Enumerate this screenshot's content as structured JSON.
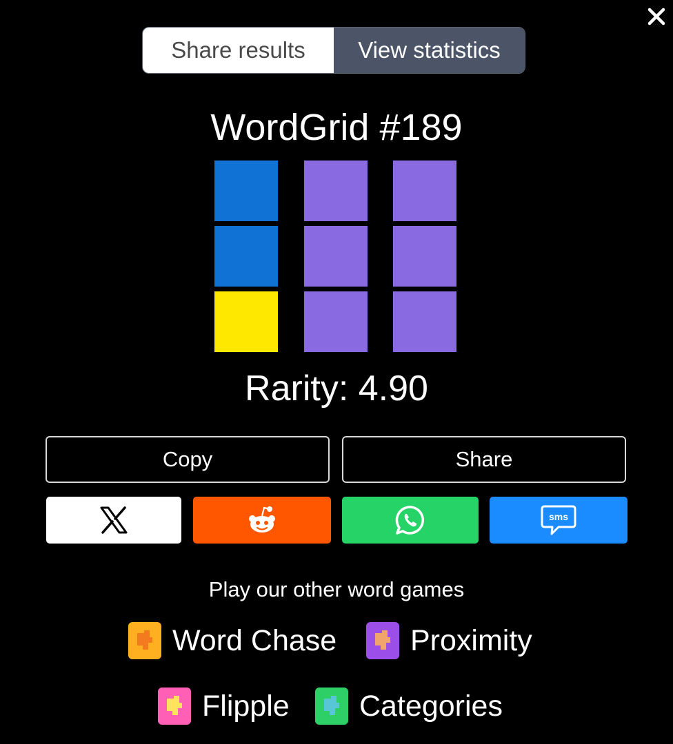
{
  "close_label": "✕",
  "tabs": [
    {
      "label": "Share results",
      "active": false
    },
    {
      "label": "View statistics",
      "active": true
    }
  ],
  "result": {
    "title": "WordGrid #189",
    "rarity": "Rarity: 4.90",
    "grid": [
      [
        "blue",
        "purple",
        "purple"
      ],
      [
        "blue",
        "purple",
        "purple"
      ],
      [
        "yellow",
        "purple",
        "purple"
      ]
    ]
  },
  "colors": {
    "blue": "#0f72d4",
    "purple": "#8a6ae0",
    "yellow": "#ffe800",
    "reddit": "#ff5700",
    "whatsapp": "#25d366",
    "sms": "#1a8cff",
    "x": "#ffffff"
  },
  "actions": {
    "copy_label": "Copy",
    "share_label": "Share"
  },
  "social": [
    {
      "name": "x-icon"
    },
    {
      "name": "reddit-icon"
    },
    {
      "name": "whatsapp-icon"
    },
    {
      "name": "sms-icon",
      "text": "sms"
    }
  ],
  "other_games": {
    "heading": "Play our other word games",
    "items": [
      {
        "label": "Word Chase",
        "color": "#ffb020",
        "accent": "#f47a20"
      },
      {
        "label": "Proximity",
        "color": "#9b4fe8",
        "accent": "#f1a46b"
      },
      {
        "label": "Flipple",
        "color": "#ff5fb5",
        "accent": "#ffe35c"
      },
      {
        "label": "Categories",
        "color": "#2fcf68",
        "accent": "#58c6d6"
      }
    ]
  }
}
